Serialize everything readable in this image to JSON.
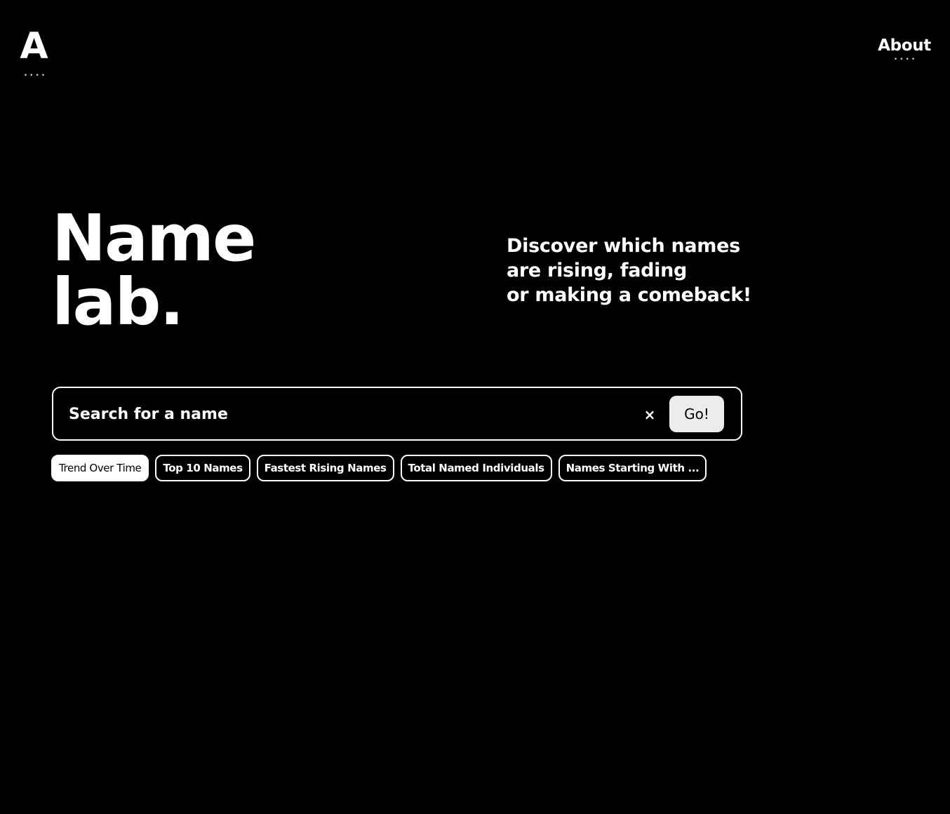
{
  "header": {
    "logo_text": "A",
    "logo_dots": "••••",
    "about_label": "About",
    "about_dots": "••••"
  },
  "hero": {
    "title_line1": "Name",
    "title_line2": "lab.",
    "tagline_line1": "Discover which names",
    "tagline_line2": "are rising, fading",
    "tagline_line3": "or making a comeback!"
  },
  "search": {
    "placeholder": "Search for a name",
    "value": "",
    "clear_label": "×",
    "go_label": "Go!"
  },
  "tabs": [
    {
      "label": "Trend Over Time",
      "active": true
    },
    {
      "label": "Top 10 Names",
      "active": false
    },
    {
      "label": "Fastest Rising Names",
      "active": false
    },
    {
      "label": "Total Named Individuals",
      "active": false
    },
    {
      "label": "Names Starting With ...",
      "active": false
    }
  ],
  "colors": {
    "background": "#000000",
    "foreground": "#ffffff",
    "button_bg": "#ececec"
  }
}
